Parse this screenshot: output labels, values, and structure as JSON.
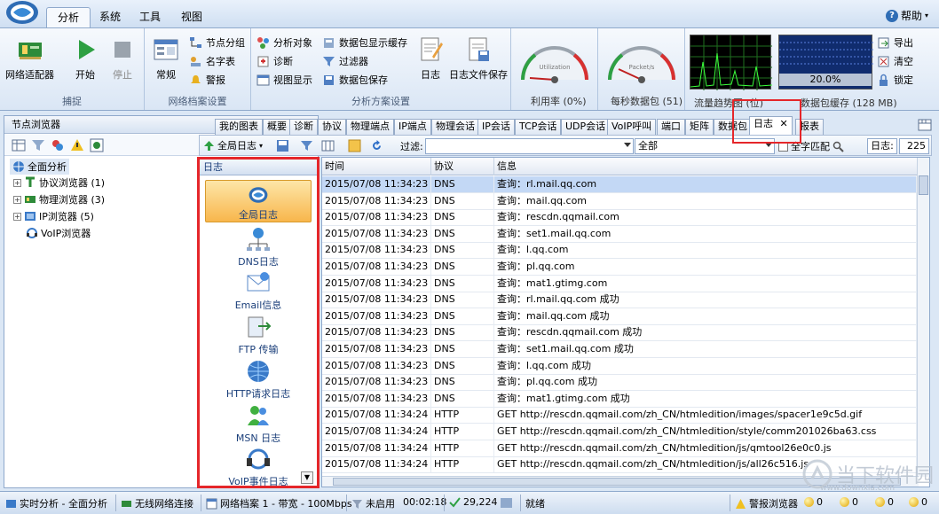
{
  "menu": {
    "tabs": [
      "分析",
      "系统",
      "工具",
      "视图"
    ],
    "active": 0,
    "help": "帮助"
  },
  "ribbon": {
    "capture": {
      "label": "捕捉",
      "adapter": "网络适配器",
      "start": "开始",
      "stop": "停止"
    },
    "profile": {
      "label": "网络档案设置",
      "normal": "常规",
      "node_group": "节点分组",
      "name_table": "名字表",
      "alarm": "警报"
    },
    "scheme": {
      "label": "分析方案设置",
      "analysis_obj": "分析对象",
      "diagnose": "诊断",
      "view_display": "视图显示",
      "pkt_buffer": "数据包显示缓存",
      "filter": "过滤器",
      "pkt_save": "数据包保存",
      "log": "日志",
      "log_save": "日志文件保存"
    },
    "gauges": [
      {
        "dial": "Utilization",
        "label": "利用率 (0%)"
      },
      {
        "dial": "Packet/s",
        "label": "每秒数据包 (51)"
      }
    ],
    "trend_label": "流量趋势图 (位)",
    "buffer": {
      "pct": "20.0%",
      "label": "数据包缓存 (128 MB)",
      "export": "导出",
      "clear": "清空",
      "lock": "锁定"
    }
  },
  "left": {
    "title": "节点浏览器",
    "tree": [
      {
        "label": "全面分析",
        "selected": true
      },
      {
        "label": "协议浏览器 (1)"
      },
      {
        "label": "物理浏览器 (3)"
      },
      {
        "label": "IP浏览器 (5)"
      },
      {
        "label": "VoIP浏览器"
      }
    ]
  },
  "tabs": [
    "我的图表",
    "概要",
    "诊断",
    "协议",
    "物理端点",
    "IP端点",
    "物理会话",
    "IP会话",
    "TCP会话",
    "UDP会话",
    "VoIP呼叫",
    "端口",
    "矩阵",
    "数据包",
    "日志",
    "报表"
  ],
  "active_tab": "日志",
  "toolbar": {
    "global_log": "全局日志",
    "filter_label": "过滤:",
    "filter_value": "",
    "scope": "全部",
    "whole_word": "全字匹配",
    "log_count_label": "日志:",
    "log_count": "225"
  },
  "log_panel": {
    "title": "日志",
    "items": [
      "全局日志",
      "DNS日志",
      "Email信息",
      "FTP 传输",
      "HTTP请求日志",
      "MSN 日志",
      "VoIP事件日志"
    ]
  },
  "grid": {
    "columns": [
      "时间",
      "协议",
      "信息"
    ],
    "rows": [
      [
        "2015/07/08 11:34:23",
        "DNS",
        "查询：rl.mail.qq.com"
      ],
      [
        "2015/07/08 11:34:23",
        "DNS",
        "查询：mail.qq.com"
      ],
      [
        "2015/07/08 11:34:23",
        "DNS",
        "查询：rescdn.qqmail.com"
      ],
      [
        "2015/07/08 11:34:23",
        "DNS",
        "查询：set1.mail.qq.com"
      ],
      [
        "2015/07/08 11:34:23",
        "DNS",
        "查询：l.qq.com"
      ],
      [
        "2015/07/08 11:34:23",
        "DNS",
        "查询：pl.qq.com"
      ],
      [
        "2015/07/08 11:34:23",
        "DNS",
        "查询：mat1.gtimg.com"
      ],
      [
        "2015/07/08 11:34:23",
        "DNS",
        "查询：rl.mail.qq.com 成功"
      ],
      [
        "2015/07/08 11:34:23",
        "DNS",
        "查询：mail.qq.com 成功"
      ],
      [
        "2015/07/08 11:34:23",
        "DNS",
        "查询：rescdn.qqmail.com 成功"
      ],
      [
        "2015/07/08 11:34:23",
        "DNS",
        "查询：set1.mail.qq.com 成功"
      ],
      [
        "2015/07/08 11:34:23",
        "DNS",
        "查询：l.qq.com 成功"
      ],
      [
        "2015/07/08 11:34:23",
        "DNS",
        "查询：pl.qq.com 成功"
      ],
      [
        "2015/07/08 11:34:23",
        "DNS",
        "查询：mat1.gtimg.com 成功"
      ],
      [
        "2015/07/08 11:34:24",
        "HTTP",
        "GET http://rescdn.qqmail.com/zh_CN/htmledition/images/spacer1e9c5d.gif"
      ],
      [
        "2015/07/08 11:34:24",
        "HTTP",
        "GET http://rescdn.qqmail.com/zh_CN/htmledition/style/comm201026ba63.css"
      ],
      [
        "2015/07/08 11:34:24",
        "HTTP",
        "GET http://rescdn.qqmail.com/zh_CN/htmledition/js/qmtool26e0c0.js"
      ],
      [
        "2015/07/08 11:34:24",
        "HTTP",
        "GET http://rescdn.qqmail.com/zh_CN/htmledition/js/all26c516.js"
      ]
    ]
  },
  "status": {
    "mode": "实时分析 - 全面分析",
    "wireless": "无线网络连接",
    "profile": "网络档案 1 - 带宽 - 100Mbps",
    "filter": "未启用",
    "elapsed": "00:02:18",
    "packets": "29,224",
    "state": "就绪",
    "alarm": "警报浏览器",
    "counts": [
      "0",
      "0",
      "0",
      "0"
    ]
  },
  "watermark": {
    "brand": "当下软件园",
    "url": "www.downxia.com"
  }
}
